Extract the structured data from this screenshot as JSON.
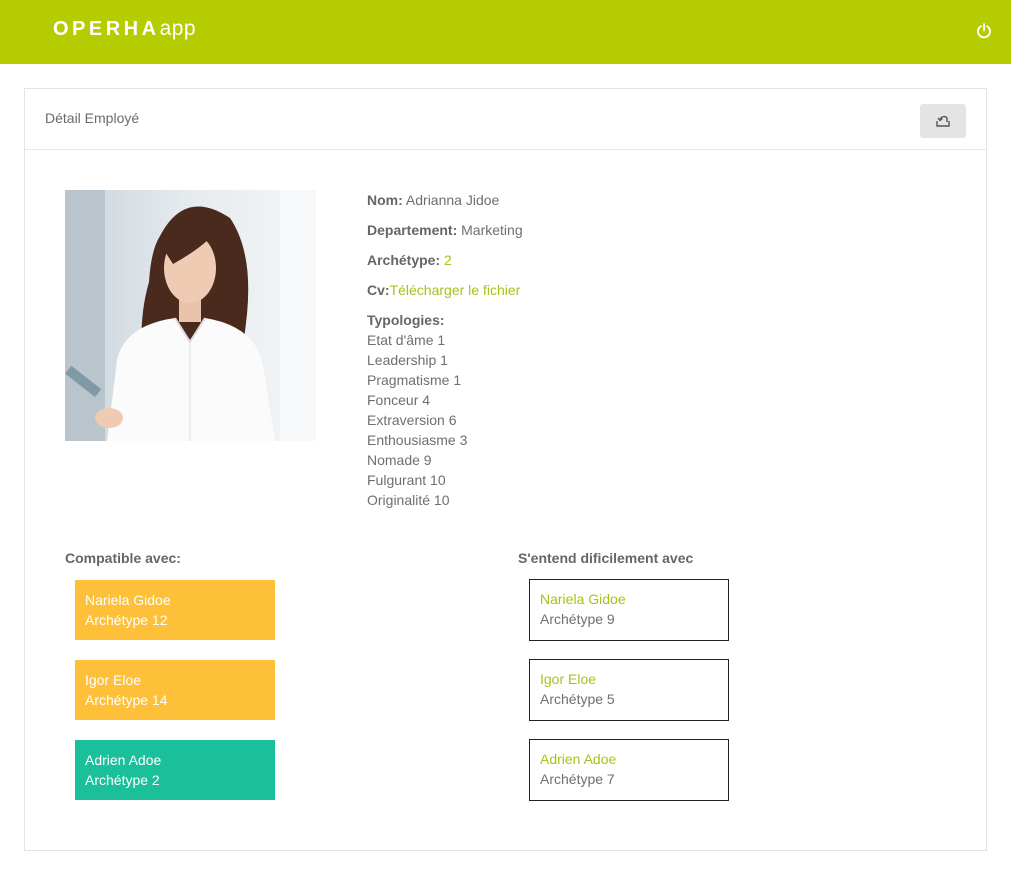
{
  "app": {
    "brand_strong": "OPERHA",
    "brand_light": "app"
  },
  "page": {
    "title": "Détail Employé"
  },
  "employee": {
    "name_label": "Nom:",
    "name": "Adrianna Jidoe",
    "department_label": "Departement:",
    "department": "Marketing",
    "archetype_label": "Archétype:",
    "archetype": "2",
    "cv_label": "Cv:",
    "cv_link": "Télécharger le fichier",
    "typologies_label": "Typologies:",
    "typologies": [
      "Etat d'âme 1",
      "Leadership 1",
      "Pragmatisme 1",
      "Fonceur 4",
      "Extraversion 6",
      "Enthousiasme 3",
      "Nomade 9",
      "Fulgurant 10",
      "Originalité 10"
    ]
  },
  "compatible": {
    "title": "Compatible avec:",
    "items": [
      {
        "name": "Nariela Gidoe",
        "archetype": "Archétype 12",
        "color": "#fec038"
      },
      {
        "name": "Igor Eloe",
        "archetype": "Archétype 14",
        "color": "#fec038"
      },
      {
        "name": "Adrien Adoe",
        "archetype": "Archétype 2",
        "color": "#1bbf9a"
      }
    ]
  },
  "difficult": {
    "title": "S'entend dificilement avec",
    "items": [
      {
        "name": "Nariela Gidoe",
        "archetype": "Archétype 9"
      },
      {
        "name": "Igor Eloe",
        "archetype": "Archétype 5"
      },
      {
        "name": "Adrien Adoe",
        "archetype": "Archétype 7"
      }
    ]
  },
  "icons": {
    "power": "power-icon",
    "export": "export-icon"
  },
  "colors": {
    "brand": "#b5cc00",
    "accent": "#a8c21a",
    "yellow": "#fec038",
    "teal": "#1bbf9a"
  }
}
